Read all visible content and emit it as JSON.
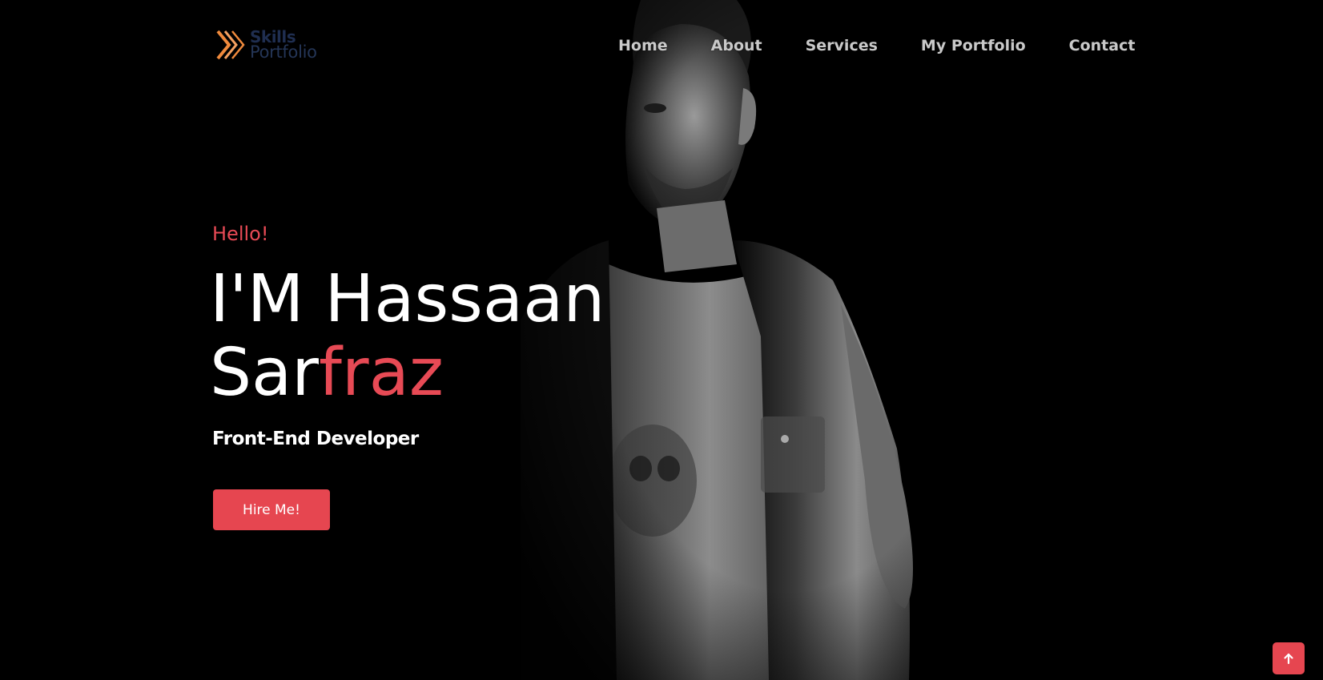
{
  "logo": {
    "line1": "Skills",
    "line2": "Portfolio",
    "icon": "chevron-logo-icon"
  },
  "nav": {
    "items": [
      {
        "label": "Home"
      },
      {
        "label": "About"
      },
      {
        "label": "Services"
      },
      {
        "label": "My Portfolio"
      },
      {
        "label": "Contact"
      }
    ]
  },
  "hero": {
    "greeting": "Hello!",
    "name_line1": "I'M Hassaan",
    "name_line2_plain": "Sar",
    "name_line2_accent": "fraz",
    "role": "Front-End Developer",
    "cta_label": "Hire Me!"
  },
  "scroll_top": {
    "icon": "arrow-up-icon"
  },
  "colors": {
    "accent": "#e74a55",
    "background": "#000000",
    "logo_orange": "#f08a3c",
    "logo_navy": "#1f2e50"
  }
}
